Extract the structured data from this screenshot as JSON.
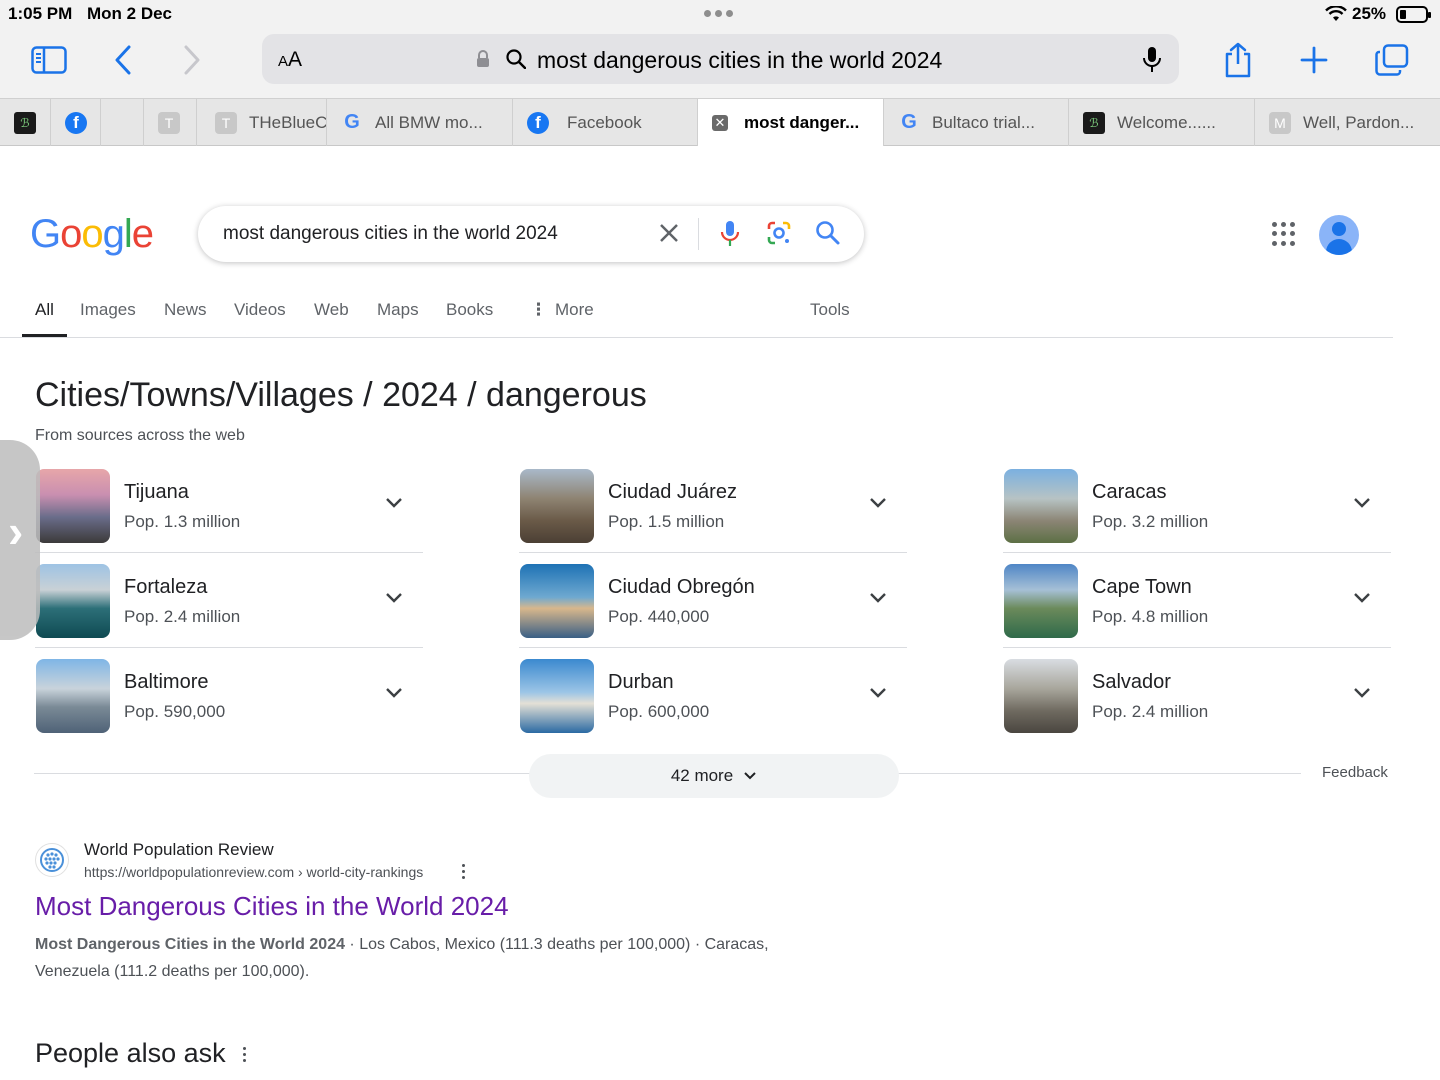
{
  "status": {
    "time": "1:05 PM",
    "date": "Mon 2 Dec",
    "battery": "25%",
    "battery_level": 0.25
  },
  "toolbar": {
    "text_size_label": "AA",
    "url": "most dangerous cities in the world 2024"
  },
  "tabs": [
    {
      "icon": "dark-favicon-icon",
      "title": ""
    },
    {
      "icon": "facebook-icon",
      "title": ""
    },
    {
      "icon": "blank-favicon-icon",
      "title": ""
    },
    {
      "icon": "letter-t-icon",
      "title": ""
    },
    {
      "icon": "letter-t-icon",
      "title": "THeBlueC"
    },
    {
      "icon": "google-icon",
      "title": "All BMW mo..."
    },
    {
      "icon": "facebook-icon",
      "title": "Facebook"
    },
    {
      "icon": "close-icon",
      "title": "most danger...",
      "active": true
    },
    {
      "icon": "google-icon",
      "title": "Bultaco trial..."
    },
    {
      "icon": "dark-favicon-icon",
      "title": "Welcome......"
    },
    {
      "icon": "letter-m-icon",
      "title": "Well, Pardon..."
    }
  ],
  "google": {
    "logo": [
      "G",
      "o",
      "o",
      "g",
      "l",
      "e"
    ],
    "query": "most dangerous cities in the world 2024"
  },
  "nav": {
    "all": "All",
    "images": "Images",
    "news": "News",
    "videos": "Videos",
    "web": "Web",
    "maps": "Maps",
    "books": "Books",
    "more": "More",
    "tools": "Tools"
  },
  "results_panel": {
    "heading": "Cities/Towns/Villages / 2024 / dangerous",
    "subheading": "From sources across the web",
    "cities": [
      {
        "name": "Tijuana",
        "pop": "Pop. 1.3 million"
      },
      {
        "name": "Ciudad Juárez",
        "pop": "Pop. 1.5 million"
      },
      {
        "name": "Caracas",
        "pop": "Pop. 3.2 million"
      },
      {
        "name": "Fortaleza",
        "pop": "Pop. 2.4 million"
      },
      {
        "name": "Ciudad Obregón",
        "pop": "Pop. 440,000"
      },
      {
        "name": "Cape Town",
        "pop": "Pop. 4.8 million"
      },
      {
        "name": "Baltimore",
        "pop": "Pop. 590,000"
      },
      {
        "name": "Durban",
        "pop": "Pop. 600,000"
      },
      {
        "name": "Salvador",
        "pop": "Pop. 2.4 million"
      }
    ],
    "more_label": "42 more",
    "feedback": "Feedback"
  },
  "result": {
    "site": "World Population Review",
    "url": "https://worldpopulationreview.com › world-city-rankings",
    "title": "Most Dangerous Cities in the World 2024",
    "snippet_bold": "Most Dangerous Cities in the World 2024",
    "snippet_rest": " · Los Cabos, Mexico (111.3 deaths per 100,000) · Caracas, Venezuela (111.2 deaths per 100,000)."
  },
  "people_also_ask": "People also ask",
  "colors": {
    "link_visited": "#681da8",
    "accent": "#1a73e8",
    "chrome_bg": "#f2f2f2"
  }
}
